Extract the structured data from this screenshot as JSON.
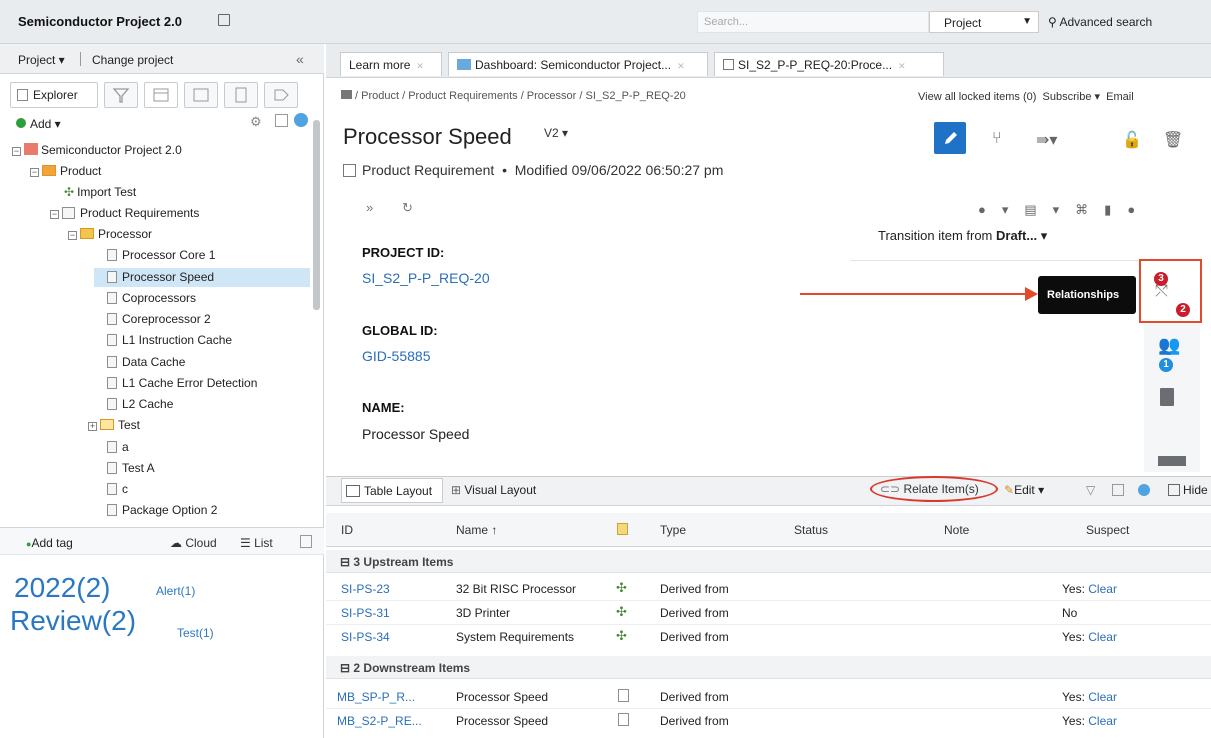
{
  "app": {
    "title": "Semiconductor Project 2.0",
    "search_placeholder": "Search...",
    "project_select": "Project",
    "advanced_search": "Advanced search"
  },
  "left": {
    "project_menu": "Project ▾",
    "change_project": "Change project",
    "explorer_tab": "Explorer",
    "add_label": "Add ▾",
    "tree": [
      {
        "label": "Semiconductor Project 2.0",
        "type": "project"
      },
      {
        "label": "Product",
        "type": "folder"
      },
      {
        "label": "Import Test",
        "type": "puzzle"
      },
      {
        "label": "Product Requirements",
        "type": "list"
      },
      {
        "label": "Processor",
        "type": "folder"
      },
      {
        "label": "Processor Core 1",
        "type": "doc"
      },
      {
        "label": "Processor Speed",
        "type": "doc",
        "selected": true
      },
      {
        "label": "Coprocessors",
        "type": "doc"
      },
      {
        "label": "Coreprocessor 2",
        "type": "doc"
      },
      {
        "label": "L1 Instruction Cache",
        "type": "doc"
      },
      {
        "label": "Data Cache",
        "type": "doc"
      },
      {
        "label": "L1 Cache Error Detection",
        "type": "doc"
      },
      {
        "label": "L2 Cache",
        "type": "doc"
      },
      {
        "label": "Test",
        "type": "folder"
      },
      {
        "label": "a",
        "type": "doc"
      },
      {
        "label": "Test A",
        "type": "doc"
      },
      {
        "label": "c",
        "type": "doc"
      },
      {
        "label": "Package Option 2",
        "type": "doc"
      }
    ],
    "add_tag": "Add tag",
    "cloud": "Cloud",
    "list": "List",
    "tags": [
      {
        "big": "2022(2)",
        "small": "Alert(1)"
      },
      {
        "big": "Review(2)",
        "small": "Test(1)"
      }
    ]
  },
  "tabs": [
    "Learn more",
    "Dashboard: Semiconductor Project...",
    "SI_S2_P-P_REQ-20:Proce..."
  ],
  "breadcrumb": "/ Product / Product Requirements / Processor / SI_S2_P-P_REQ-20",
  "header_right": {
    "locked": "View all locked items (0)",
    "subscribe": "Subscribe ▾",
    "email": "Email"
  },
  "item": {
    "title": "Processor Speed",
    "version": "V2 ▾",
    "meta_type": "Product Requirement",
    "meta_modified": "Modified 09/06/2022 06:50:27 pm",
    "transition_prefix": "Transition item from ",
    "transition_state": "Draft...",
    "fields": [
      {
        "label": "PROJECT ID:",
        "value": "SI_S2_P-P_REQ-20",
        "link": true
      },
      {
        "label": "GLOBAL ID:",
        "value": "GID-55885",
        "link": true
      },
      {
        "label": "NAME:",
        "value": "Processor Speed",
        "link": false
      }
    ]
  },
  "relationships": {
    "tooltip": "Relationships",
    "upstream_badge": "3",
    "downstream_badge": "2",
    "comments_badge": "1"
  },
  "bottom": {
    "table_layout": "Table Layout",
    "visual_layout": "Visual Layout",
    "relate": "Relate Item(s)",
    "edit": "Edit ▾",
    "hide": "Hide",
    "columns": [
      "ID",
      "Name ↑",
      "Type",
      "Status",
      "Note",
      "Suspect"
    ],
    "groups": [
      {
        "label": "3 Upstream Items",
        "rows": [
          {
            "id": "SI-PS-23",
            "name": "32 Bit RISC Processor",
            "type": "Derived from",
            "status": "",
            "note": "",
            "suspect": "Yes:",
            "clear": "Clear",
            "icon": "puzzle"
          },
          {
            "id": "SI-PS-31",
            "name": "3D Printer",
            "type": "Derived from",
            "status": "",
            "note": "",
            "suspect": "No",
            "clear": "",
            "icon": "puzzle"
          },
          {
            "id": "SI-PS-34",
            "name": "System Requirements",
            "type": "Derived from",
            "status": "",
            "note": "",
            "suspect": "Yes:",
            "clear": "Clear",
            "icon": "puzzle"
          }
        ]
      },
      {
        "label": "2 Downstream Items",
        "rows": [
          {
            "id": "MB_SP-P_R...",
            "name": "Processor Speed",
            "type": "Derived from",
            "status": "",
            "note": "",
            "suspect": "Yes:",
            "clear": "Clear",
            "icon": "doc"
          },
          {
            "id": "MB_S2-P_RE...",
            "name": "Processor Speed",
            "type": "Derived from",
            "status": "",
            "note": "",
            "suspect": "Yes:",
            "clear": "Clear",
            "icon": "doc"
          }
        ]
      }
    ]
  }
}
